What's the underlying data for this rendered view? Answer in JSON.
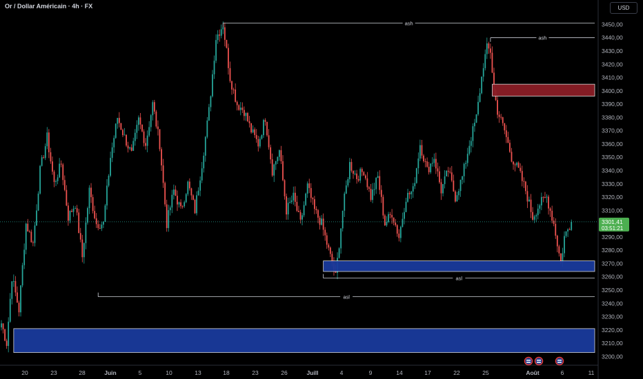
{
  "header": {
    "title": "Or / Dollar Américain · 4h · FX",
    "currency_button": "USD"
  },
  "colors": {
    "background": "#000000",
    "up_candle": "#26a69a",
    "down_candle": "#ef5350",
    "supply_zone": "#8b1e26",
    "demand_zone": "#1a3a9c",
    "price_label_bg": "#4caf50"
  },
  "chart_data": {
    "type": "candlestick",
    "symbol": "Or / Dollar Américain",
    "interval": "4h",
    "ylim": [
      3195,
      3458
    ],
    "y_ticks": [
      3200,
      3210,
      3220,
      3230,
      3240,
      3250,
      3260,
      3270,
      3280,
      3290,
      3300,
      3310,
      3320,
      3330,
      3340,
      3350,
      3360,
      3370,
      3380,
      3390,
      3400,
      3410,
      3420,
      3430,
      3440,
      3450
    ],
    "y_tick_labels": [
      "3200,00",
      "3210,00",
      "3220,00",
      "3230,00",
      "3240,00",
      "3250,00",
      "3260,00",
      "3270,00",
      "3280,00",
      "3290,00",
      "3300,00",
      "3310,00",
      "3320,00",
      "3330,00",
      "3340,00",
      "3350,00",
      "3360,00",
      "3370,00",
      "3380,00",
      "3390,00",
      "3400,00",
      "3410,00",
      "3420,00",
      "3430,00",
      "3440,00",
      "3450,00"
    ],
    "x_labels": [
      "20",
      "23",
      "28",
      "Juin",
      "5",
      "10",
      "13",
      "18",
      "23",
      "26",
      "Juill",
      "4",
      "9",
      "14",
      "17",
      "22",
      "25",
      "Août",
      "6",
      "11"
    ],
    "bold_x_labels": [
      "Juin",
      "Juill",
      "Août"
    ],
    "last_price": "3301,41",
    "countdown": "03:51:21",
    "price_path": [
      [
        0,
        3225
      ],
      [
        3,
        3210
      ],
      [
        6,
        3260
      ],
      [
        10,
        3235
      ],
      [
        14,
        3300
      ],
      [
        18,
        3285
      ],
      [
        22,
        3340
      ],
      [
        26,
        3365
      ],
      [
        30,
        3330
      ],
      [
        34,
        3345
      ],
      [
        38,
        3305
      ],
      [
        42,
        3315
      ],
      [
        46,
        3275
      ],
      [
        50,
        3325
      ],
      [
        54,
        3300
      ],
      [
        58,
        3300
      ],
      [
        62,
        3350
      ],
      [
        66,
        3380
      ],
      [
        70,
        3365
      ],
      [
        74,
        3352
      ],
      [
        78,
        3378
      ],
      [
        82,
        3360
      ],
      [
        86,
        3390
      ],
      [
        90,
        3360
      ],
      [
        94,
        3300
      ],
      [
        98,
        3325
      ],
      [
        102,
        3310
      ],
      [
        106,
        3330
      ],
      [
        110,
        3310
      ],
      [
        114,
        3345
      ],
      [
        118,
        3385
      ],
      [
        122,
        3440
      ],
      [
        126,
        3450
      ],
      [
        130,
        3410
      ],
      [
        134,
        3390
      ],
      [
        138,
        3385
      ],
      [
        142,
        3370
      ],
      [
        146,
        3360
      ],
      [
        150,
        3380
      ],
      [
        154,
        3340
      ],
      [
        158,
        3355
      ],
      [
        162,
        3310
      ],
      [
        166,
        3320
      ],
      [
        170,
        3300
      ],
      [
        174,
        3328
      ],
      [
        178,
        3310
      ],
      [
        182,
        3300
      ],
      [
        186,
        3280
      ],
      [
        190,
        3260
      ],
      [
        194,
        3310
      ],
      [
        198,
        3345
      ],
      [
        202,
        3335
      ],
      [
        206,
        3340
      ],
      [
        210,
        3320
      ],
      [
        214,
        3335
      ],
      [
        218,
        3300
      ],
      [
        222,
        3308
      ],
      [
        226,
        3290
      ],
      [
        230,
        3320
      ],
      [
        234,
        3325
      ],
      [
        238,
        3360
      ],
      [
        242,
        3340
      ],
      [
        246,
        3350
      ],
      [
        250,
        3325
      ],
      [
        254,
        3340
      ],
      [
        258,
        3320
      ],
      [
        262,
        3335
      ],
      [
        266,
        3360
      ],
      [
        270,
        3380
      ],
      [
        274,
        3420
      ],
      [
        276,
        3432
      ],
      [
        278,
        3430
      ],
      [
        280,
        3400
      ],
      [
        282,
        3385
      ],
      [
        286,
        3370
      ],
      [
        290,
        3350
      ],
      [
        294,
        3340
      ],
      [
        298,
        3325
      ],
      [
        302,
        3305
      ],
      [
        306,
        3315
      ],
      [
        310,
        3320
      ],
      [
        314,
        3300
      ],
      [
        318,
        3270
      ],
      [
        320,
        3290
      ],
      [
        324,
        3301.41
      ]
    ],
    "zones": [
      {
        "type": "supply",
        "from_bar": 279,
        "y_low": 3396,
        "y_high": 3405
      },
      {
        "type": "demand",
        "from_bar": 183,
        "y_low": 3264,
        "y_high": 3272
      },
      {
        "type": "demand",
        "from_bar": 7,
        "y_low": 3203,
        "y_high": 3221
      }
    ],
    "levels": [
      {
        "label": "ash",
        "value": 3451,
        "from_bar": 126
      },
      {
        "label": "ash",
        "value": 3440,
        "from_bar": 278
      },
      {
        "label": "asl",
        "value": 3259,
        "from_bar": 183
      },
      {
        "label": "asl",
        "value": 3245,
        "from_bar": 55
      }
    ]
  }
}
